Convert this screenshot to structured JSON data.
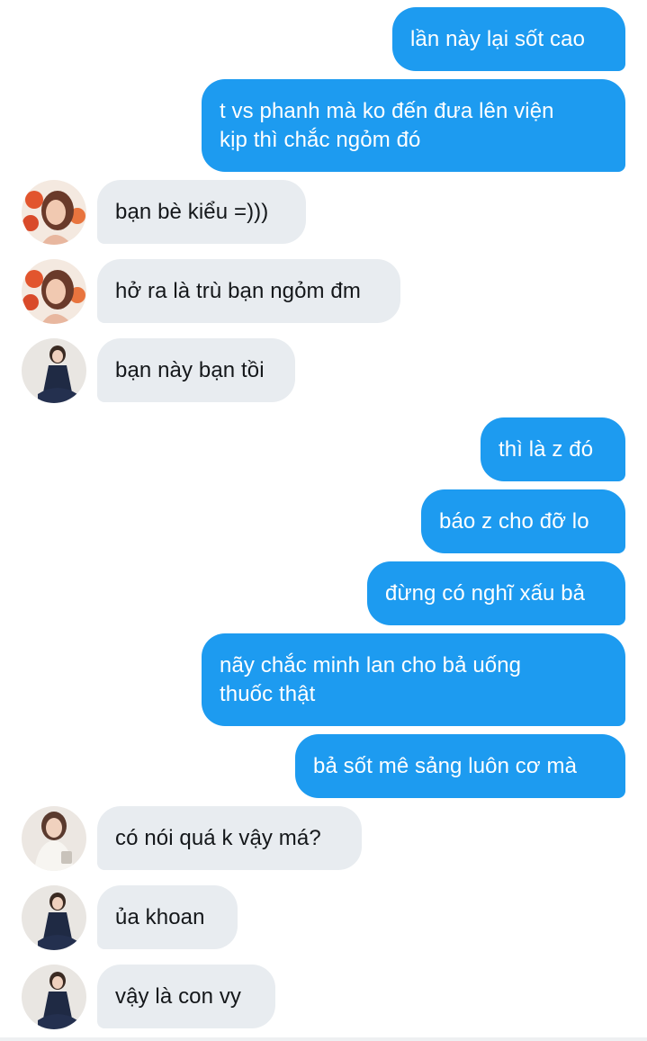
{
  "messages": [
    {
      "from": "me",
      "text": "lần này lại sốt cao"
    },
    {
      "from": "me",
      "text": "t vs phanh mà ko đến đưa lên viện\nkịp thì chắc ngỏm đó"
    },
    {
      "from": "other",
      "avatar": "portrait-red-flowers",
      "text": "bạn bè kiểu =)))"
    },
    {
      "from": "other",
      "avatar": "portrait-red-flowers",
      "text": "hở ra là trù bạn ngỏm đm"
    },
    {
      "from": "other",
      "avatar": "portrait-dark-dress",
      "text": "bạn này bạn tồi"
    },
    {
      "from": "me",
      "text": "thì là z đó"
    },
    {
      "from": "me",
      "text": "báo z cho đỡ lo"
    },
    {
      "from": "me",
      "text": "đừng có nghĩ xấu bả"
    },
    {
      "from": "me",
      "text": "nãy chắc minh lan cho bả uống\nthuốc thật"
    },
    {
      "from": "me",
      "text": "bả sốt mê sảng luôn cơ mà"
    },
    {
      "from": "other",
      "avatar": "portrait-white-sweater",
      "text": "có nói quá k vậy má?"
    },
    {
      "from": "other",
      "avatar": "portrait-dark-dress",
      "text": "ủa khoan"
    },
    {
      "from": "other",
      "avatar": "portrait-dark-dress",
      "text": "vậy là con vy"
    }
  ],
  "colors": {
    "outgoing_bubble": "#1d9bf0",
    "incoming_bubble": "#e8ecf0",
    "outgoing_text": "#ffffff",
    "incoming_text": "#14171a"
  }
}
